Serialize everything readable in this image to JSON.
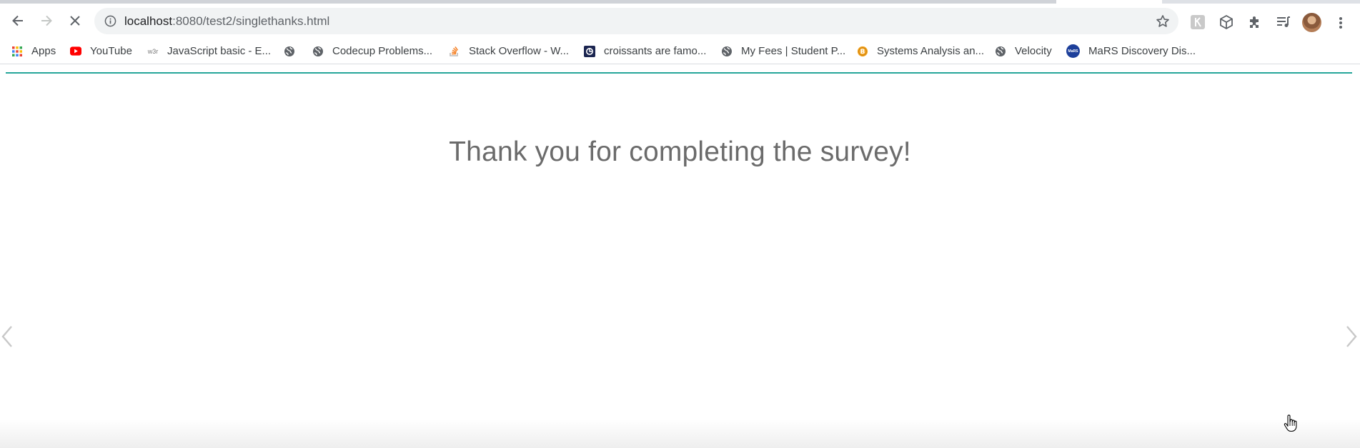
{
  "browser": {
    "url_host": "localhost",
    "url_path": ":8080/test2/singlethanks.html"
  },
  "bookmarks": [
    {
      "label": "Apps",
      "icon": "apps-grid-icon"
    },
    {
      "label": "YouTube",
      "icon": "youtube-icon"
    },
    {
      "label": "JavaScript basic - E...",
      "icon": "w3r-icon",
      "icon_text": "w3r"
    },
    {
      "label": "",
      "icon": "globe-icon"
    },
    {
      "label": "Codecup Problems...",
      "icon": "globe-icon"
    },
    {
      "label": "Stack Overflow - W...",
      "icon": "stackoverflow-icon"
    },
    {
      "label": "croissants are famo...",
      "icon": "croissant-site-icon"
    },
    {
      "label": "My Fees | Student P...",
      "icon": "globe-icon"
    },
    {
      "label": "Systems Analysis an...",
      "icon": "coin-icon"
    },
    {
      "label": "Velocity",
      "icon": "globe-icon"
    },
    {
      "label": "MaRS Discovery Dis...",
      "icon": "mars-icon",
      "icon_text": "MaRS"
    }
  ],
  "page": {
    "message": "Thank you for completing the survey!"
  },
  "colors": {
    "accent_line": "#26a69a",
    "message_text": "#6b6b6b",
    "youtube_red": "#ff0000"
  }
}
